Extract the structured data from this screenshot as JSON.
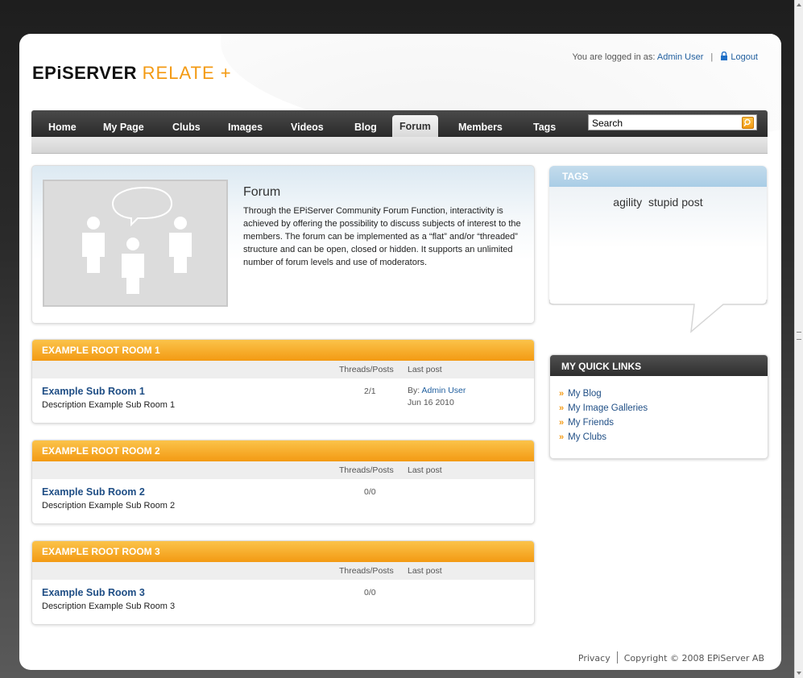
{
  "header": {
    "logo_main": "EPiSERVER",
    "logo_sub": "RELATE +",
    "logged_in_label": "You are logged in as:",
    "user_name": "Admin User",
    "logout_label": "Logout"
  },
  "nav": {
    "items": [
      {
        "label": "Home"
      },
      {
        "label": "My Page"
      },
      {
        "label": "Clubs"
      },
      {
        "label": "Images"
      },
      {
        "label": "Videos"
      },
      {
        "label": "Blog"
      },
      {
        "label": "Forum",
        "active": true
      },
      {
        "label": "Members"
      },
      {
        "label": "Tags"
      }
    ],
    "search_value": "Search"
  },
  "forum": {
    "title": "Forum",
    "description": "Through the EPiServer Community Forum Function, interactivity is achieved by offering the possibility to discuss subjects of interest to the members. The forum can be implemented as a “flat” and/or “threaded” structure and can be open, closed or hidden. It supports an unlimited number of forum levels and use of moderators."
  },
  "columns": {
    "threads_posts": "Threads/Posts",
    "last_post": "Last post"
  },
  "rooms": [
    {
      "title": "EXAMPLE ROOT ROOM 1",
      "sub_title": "Example Sub Room 1",
      "sub_desc": "Description Example Sub Room 1",
      "threads_posts": "2/1",
      "last_by_label": "By:",
      "last_by_user": "Admin User",
      "last_date": "Jun 16 2010"
    },
    {
      "title": "EXAMPLE ROOT ROOM 2",
      "sub_title": "Example Sub Room 2",
      "sub_desc": "Description Example Sub Room 2",
      "threads_posts": "0/0"
    },
    {
      "title": "EXAMPLE ROOT ROOM 3",
      "sub_title": "Example Sub Room 3",
      "sub_desc": "Description Example Sub Room 3",
      "threads_posts": "0/0"
    }
  ],
  "tags": {
    "header": "TAGS",
    "items": [
      "agility",
      "stupid post"
    ]
  },
  "quick_links": {
    "header": "MY QUICK LINKS",
    "items": [
      "My Blog",
      "My Image Galleries",
      "My Friends",
      "My Clubs"
    ]
  },
  "footer": {
    "privacy": "Privacy",
    "copyright": "Copyright © 2008 EPiServer AB"
  },
  "colors": {
    "accent": "#f39a13",
    "link": "#1f4e85",
    "nav_bg": "#2a2a2a",
    "tags_header": "#a9cde6"
  },
  "icons": {
    "logout": "lock-icon",
    "search": "search-icon",
    "link_bullet": "double-chevron-icon"
  }
}
